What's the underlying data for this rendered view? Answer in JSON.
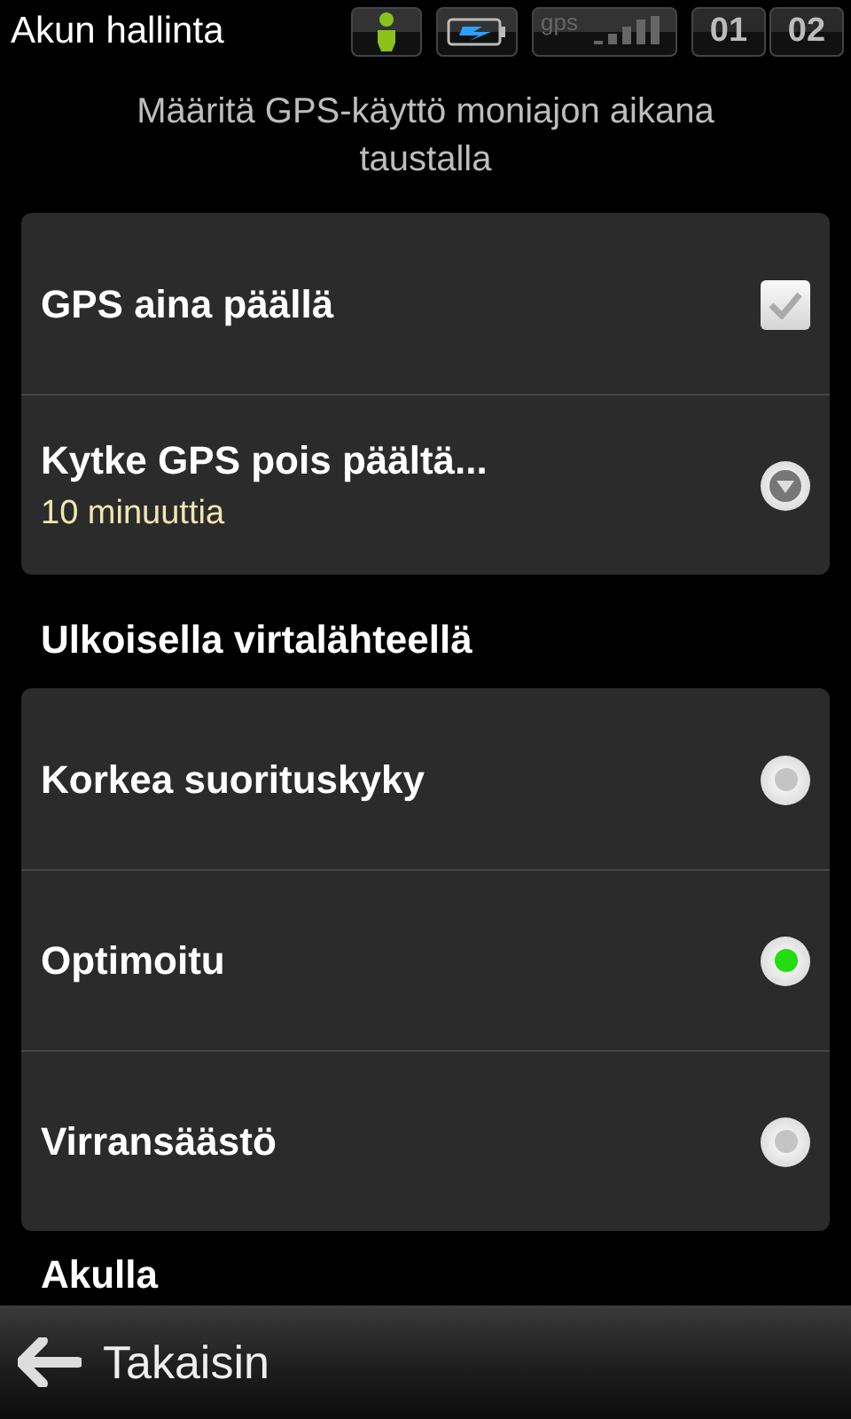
{
  "status_bar": {
    "title": "Akun hallinta",
    "gps_label": "gps",
    "clock": [
      "01",
      "02"
    ]
  },
  "subtitle": "Määritä GPS-käyttö moniajon aikana taustalla",
  "gps_settings": [
    {
      "kind": "checkbox",
      "label": "GPS aina päällä",
      "checked": true
    },
    {
      "kind": "dropdown",
      "label": "Kytke GPS pois päältä...",
      "value": "10 minuuttia"
    }
  ],
  "external_power": {
    "heading": "Ulkoisella virtalähteellä",
    "options": [
      {
        "label": "Korkea suorituskyky",
        "selected": false
      },
      {
        "label": "Optimoitu",
        "selected": true
      },
      {
        "label": "Virransäästö",
        "selected": false
      }
    ]
  },
  "battery_heading": "Akulla",
  "back_button": "Takaisin"
}
